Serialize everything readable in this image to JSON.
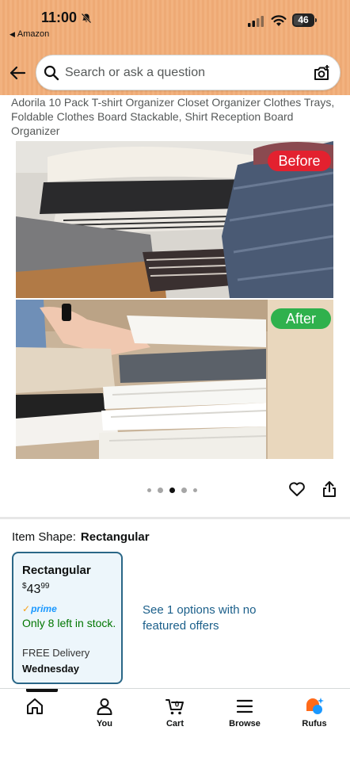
{
  "status_bar": {
    "time": "11:00",
    "back_app": "Amazon",
    "battery": "46"
  },
  "search": {
    "placeholder": "Search or ask a question"
  },
  "product": {
    "title": "Adorila 10 Pack T-shirt Organizer Closet Organizer Clothes Trays, Foldable Clothes Board Stackable, Shirt Reception Board Organizer",
    "image_badges": {
      "before": "Before",
      "after": "After"
    },
    "carousel": {
      "total": 5,
      "active_index": 2
    }
  },
  "item_shape": {
    "label": "Item Shape:",
    "value": "Rectangular"
  },
  "variant": {
    "name": "Rectangular",
    "price_symbol": "$",
    "price_whole": "43",
    "price_fraction": "99",
    "prime": "prime",
    "stock": "Only 8 left in stock.",
    "delivery": "FREE Delivery",
    "delivery_day": "Wednesday"
  },
  "see_options": "See 1 options with no featured offers",
  "bottom_nav": {
    "items": [
      {
        "label": "",
        "icon": "home-icon"
      },
      {
        "label": "You",
        "icon": "person-icon"
      },
      {
        "label": "Cart",
        "icon": "cart-icon",
        "count": "0"
      },
      {
        "label": "Browse",
        "icon": "menu-icon"
      },
      {
        "label": "Rufus",
        "icon": "rufus-icon"
      }
    ]
  },
  "colors": {
    "header_bg": "#f2b27f",
    "before_badge": "#e3212f",
    "after_badge": "#2fb14d",
    "prime_blue": "#1a98ff",
    "stock_green": "#007600",
    "link_blue": "#1b5f8a",
    "variant_border": "#2a6787"
  }
}
